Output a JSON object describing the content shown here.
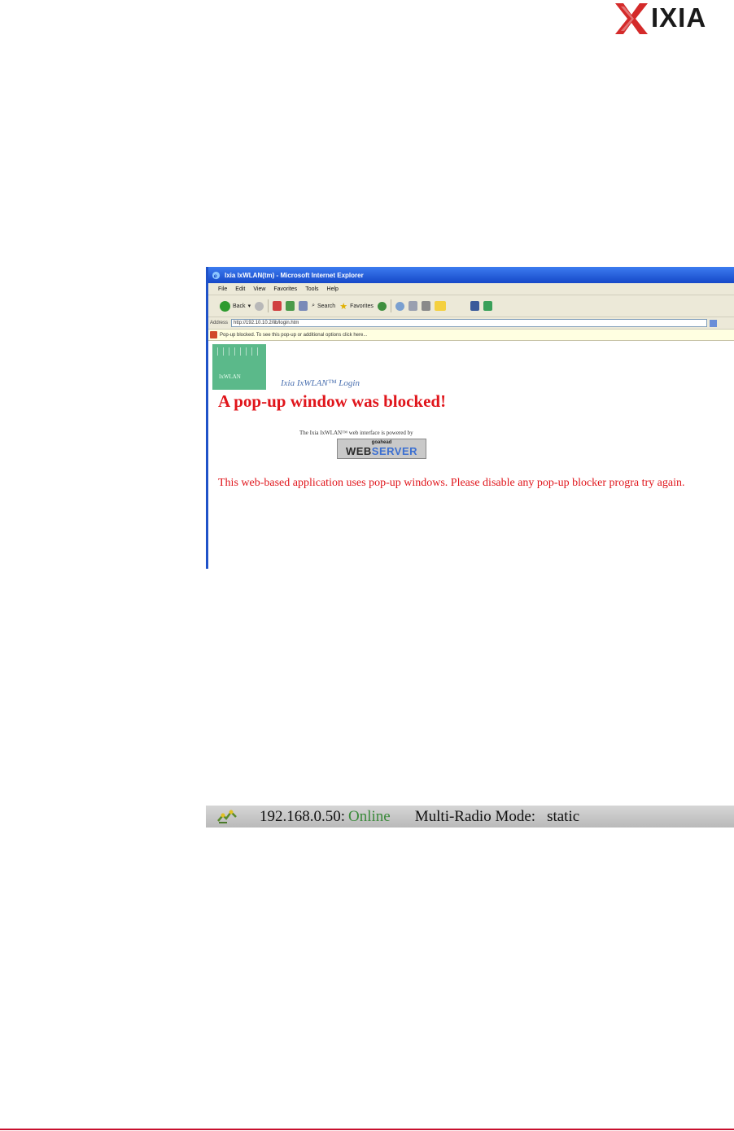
{
  "logo": {
    "text": "IXIA"
  },
  "browser": {
    "title": "Ixia IxWLAN(tm) - Microsoft Internet Explorer",
    "menu": [
      "File",
      "Edit",
      "View",
      "Favorites",
      "Tools",
      "Help"
    ],
    "toolbar": {
      "back": "Back",
      "search": "Search",
      "favorites": "Favorites"
    },
    "address_label": "Address",
    "address_value": "http://192.10.10.2/lib/login.htm",
    "infobar": "Pop-up blocked. To see this pop-up or additional options click here...",
    "page": {
      "logo_text": "IxWLAN",
      "login_link": "Ixia IxWLAN™ Login",
      "heading": "A pop-up window was blocked!",
      "powered_by": "The Ixia IxWLAN™ web interface is powered by",
      "webserver_small": "goahead",
      "webserver_word1": "WEB",
      "webserver_word2": "SERVER",
      "message": "This web-based application uses pop-up windows. Please disable any pop-up blocker progra try again."
    }
  },
  "statusbar": {
    "ip": "192.168.0.50:",
    "state": "Online",
    "mode_label": "Multi-Radio Mode:",
    "mode_value": "static"
  },
  "colors": {
    "accent_red": "#e0151b",
    "footer_rule": "#c8102e",
    "xp_blue": "#1f52c8",
    "lowlan_green": "#5bb98a"
  }
}
